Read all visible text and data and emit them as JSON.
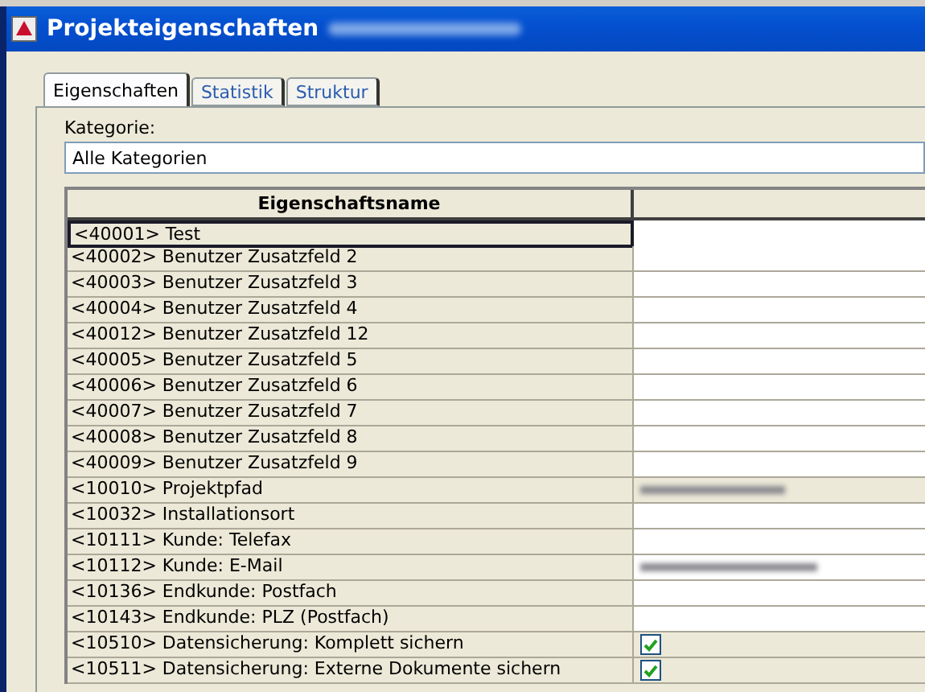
{
  "window": {
    "title": "Projekteigenschaften"
  },
  "tabs": [
    {
      "label": "Eigenschaften",
      "selected": true
    },
    {
      "label": "Statistik",
      "selected": false
    },
    {
      "label": "Struktur",
      "selected": false
    }
  ],
  "category": {
    "label": "Kategorie:",
    "value": "Alle Kategorien"
  },
  "table": {
    "columns": [
      "Eigenschaftsname"
    ],
    "rows": [
      {
        "name": "<40001> Test",
        "selected": true,
        "kind": "text"
      },
      {
        "name": "<40002> Benutzer Zusatzfeld 2",
        "selected": false,
        "kind": "text"
      },
      {
        "name": "<40003> Benutzer Zusatzfeld 3",
        "selected": false,
        "kind": "text"
      },
      {
        "name": "<40004> Benutzer Zusatzfeld 4",
        "selected": false,
        "kind": "text"
      },
      {
        "name": "<40012> Benutzer Zusatzfeld 12",
        "selected": false,
        "kind": "text"
      },
      {
        "name": "<40005> Benutzer Zusatzfeld 5",
        "selected": false,
        "kind": "text"
      },
      {
        "name": "<40006> Benutzer Zusatzfeld 6",
        "selected": false,
        "kind": "text"
      },
      {
        "name": "<40007> Benutzer Zusatzfeld 7",
        "selected": false,
        "kind": "text"
      },
      {
        "name": "<40008> Benutzer Zusatzfeld 8",
        "selected": false,
        "kind": "text"
      },
      {
        "name": "<40009> Benutzer Zusatzfeld 9",
        "selected": false,
        "kind": "text"
      },
      {
        "name": "<10010> Projektpfad",
        "selected": false,
        "kind": "readonly-redacted"
      },
      {
        "name": "<10032> Installationsort",
        "selected": false,
        "kind": "text"
      },
      {
        "name": "<10111> Kunde: Telefax",
        "selected": false,
        "kind": "text"
      },
      {
        "name": "<10112> Kunde: E-Mail",
        "selected": false,
        "kind": "redacted"
      },
      {
        "name": "<10136> Endkunde: Postfach",
        "selected": false,
        "kind": "text"
      },
      {
        "name": "<10143> Endkunde: PLZ (Postfach)",
        "selected": false,
        "kind": "text"
      },
      {
        "name": "<10510> Datensicherung: Komplett sichern",
        "selected": false,
        "kind": "checkbox",
        "checked": true
      },
      {
        "name": "<10511> Datensicherung: Externe Dokumente sichern",
        "selected": false,
        "kind": "checkbox",
        "checked": true
      }
    ]
  }
}
